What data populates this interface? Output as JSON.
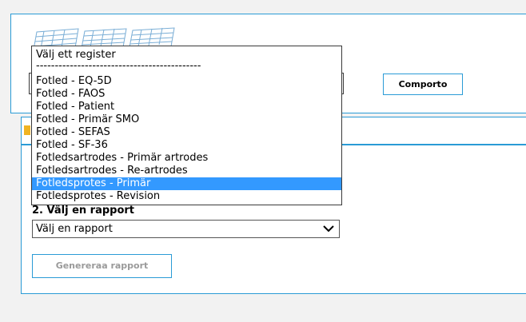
{
  "header": {
    "compare_button_label": "Comporto"
  },
  "register_dropdown": {
    "placeholder": "Välj ett register",
    "separator": "--------------------------------------------",
    "selected_index": 9,
    "options": [
      "Fotled - EQ-5D",
      "Fotled - FAOS",
      "Fotled - Patient",
      "Fotled - Primär SMO",
      "Fotled - SEFAS",
      "Fotled - SF-36",
      "Fotledsartrodes - Primär artrodes",
      "Fotledsartrodes - Re-artrodes",
      "Fotledsprotes - Primär",
      "Fotledsprotes - Revision"
    ]
  },
  "report_section": {
    "label": "2. Välj en rapport",
    "select_value": "Välj en rapport",
    "generate_button_label": "Genereraa rapport"
  },
  "colors": {
    "accent": "#2a9bd6",
    "selection": "#3399ff",
    "tab_marker": "#f0b323"
  }
}
